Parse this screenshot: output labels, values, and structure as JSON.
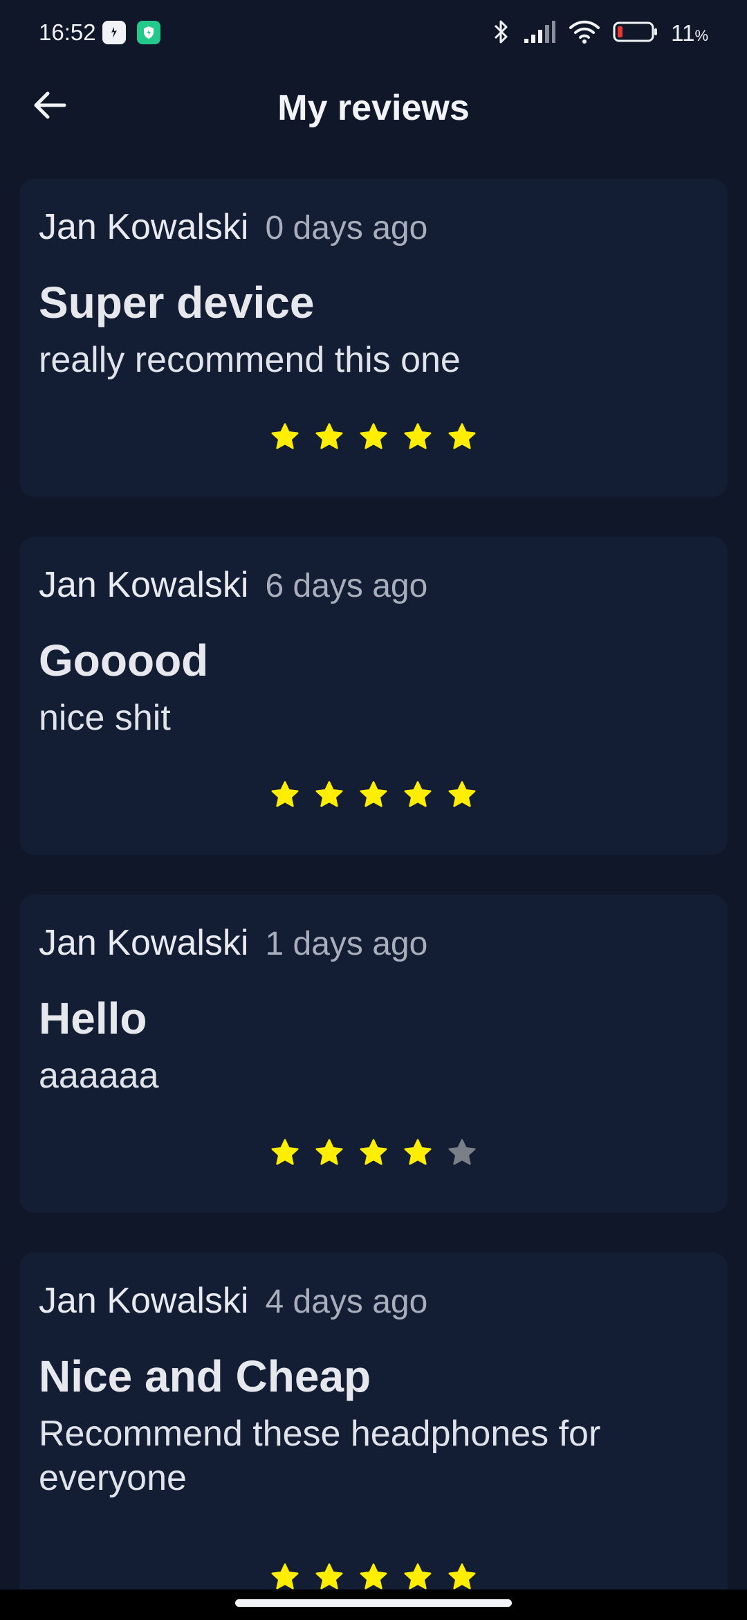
{
  "status_bar": {
    "time": "16:52",
    "battery_percent": "11",
    "battery_unit": "%",
    "icons": [
      "bluetooth-icon",
      "signal-icon",
      "wifi-icon",
      "battery-icon"
    ]
  },
  "header": {
    "title": "My reviews",
    "back_icon": "arrow-left-icon"
  },
  "colors": {
    "background": "#0f1729",
    "card": "#131d33",
    "star_filled": "#ffee00",
    "star_empty": "#7a7f87"
  },
  "reviews": [
    {
      "author": "Jan Kowalski",
      "date": "0 days ago",
      "title": "Super device",
      "body": "really recommend this one",
      "rating": 5,
      "max_rating": 5
    },
    {
      "author": "Jan Kowalski",
      "date": "6 days ago",
      "title": "Gooood",
      "body": "nice shit",
      "rating": 5,
      "max_rating": 5
    },
    {
      "author": "Jan Kowalski",
      "date": "1 days ago",
      "title": "Hello",
      "body": "aaaaaa",
      "rating": 4,
      "max_rating": 5
    },
    {
      "author": "Jan Kowalski",
      "date": "4 days ago",
      "title": "Nice and Cheap",
      "body": "Recommend these headphones for everyone",
      "rating": 5,
      "max_rating": 5
    }
  ]
}
